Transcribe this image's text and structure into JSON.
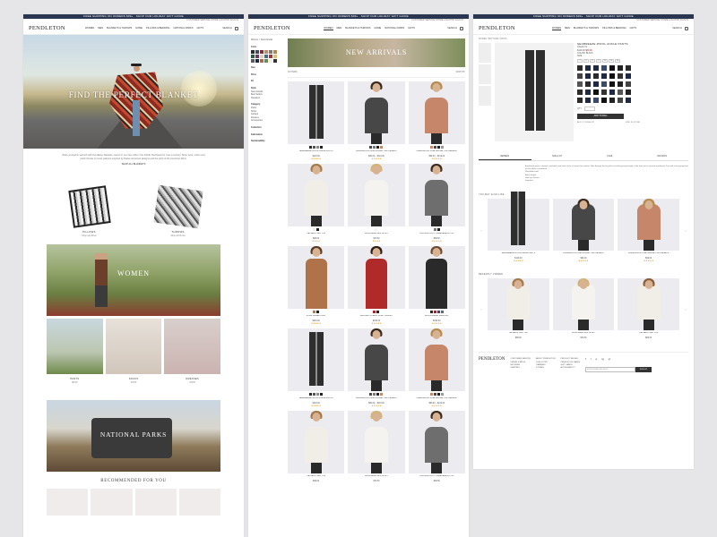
{
  "common": {
    "banner": "FREE SHIPPING ON ORDERS $99+ · SHOP OUR HOLIDAY GIFT GUIDE",
    "util": "CUSTOMER SERVICE   STORE LOCATOR   SIGN IN",
    "logo": "PENDLETON",
    "nav": [
      "WOMEN",
      "MEN",
      "BLANKETS & THROWS",
      "HOME",
      "PILLOWS & BEDDING",
      "NATIONAL PARKS",
      "GIFTS",
      "SALE"
    ],
    "search": "SEARCH",
    "cart_icon": "bag-icon"
  },
  "home": {
    "hero_title": "FIND THE PERFECT BLANKET",
    "intro": "Wrap yourself in warmth with Pendleton blankets, woven in our own mills in the Pacific Northwest for over a century. Shop wool, cotton and plush throws in iconic patterns inspired by Native American designs and the spirit of the American West.",
    "intro_link": "SHOP ALL BLANKETS",
    "duo": [
      {
        "title": "PILLOWS",
        "sub": "Shop all pillows"
      },
      {
        "title": "THROWS",
        "sub": "Shop all throws"
      }
    ],
    "women_title": "WOMEN",
    "women_tiles": [
      {
        "title": "PANTS",
        "sub": "SHOP"
      },
      {
        "title": "SOCKS",
        "sub": "SHOP"
      },
      {
        "title": "DRESSES",
        "sub": "SHOP"
      }
    ],
    "np_title": "NATIONAL PARKS",
    "reco_title": "RECOMMENDED FOR YOU"
  },
  "category": {
    "breadcrumb": "Women > New Arrivals",
    "filter_heads": [
      "Color",
      "Size",
      "Price",
      "Fit",
      "Style",
      "Category",
      "Collection",
      "Fabrication",
      "Sustainability"
    ],
    "filter_items": [
      "New Arrivals",
      "Best Sellers",
      "Sweaters",
      "Pants",
      "Shirts",
      "Jackets",
      "Dresses",
      "Accessories"
    ],
    "banner_title": "NEW ARRIVALS",
    "sort": "SORT BY",
    "count": "48 ITEMS",
    "products": [
      {
        "name": "SEABREEZE WOOL ANKLE PANTS",
        "price": "$129.00",
        "stars": "★★★★★",
        "colors": [
          "#2b2b2b",
          "#555",
          "#8a8a8a",
          "#222"
        ],
        "garment": "#2e2e2e",
        "hair": "#6b4a2f",
        "kind": "pants"
      },
      {
        "name": "LAMBSWOOL FINE GAUGE TURTLENECK",
        "price": "$99.00 – $119.00",
        "stars": "★★★★★",
        "colors": [
          "#4a4a4a",
          "#777",
          "#222",
          "#c38a6a"
        ],
        "garment": "#474747",
        "hair": "#3a2a1e",
        "kind": "top"
      },
      {
        "name": "LAMBSWOOL FINE GAUGE TURTLENECK",
        "price": "$99.00 – $119.00",
        "stars": "★★★★★",
        "colors": [
          "#c38a6a",
          "#4a4a4a",
          "#222",
          "#999"
        ],
        "garment": "#c5866a",
        "hair": "#b78a4d",
        "kind": "top"
      },
      {
        "name": "TIE-NECK SILK TOP",
        "price": "$89.00",
        "stars": "★★★★",
        "colors": [
          "#f2efe9",
          "#222"
        ],
        "garment": "#f1eee8",
        "hair": "#a57a4a",
        "kind": "top"
      },
      {
        "name": "WASHABLE SILK SHIRT",
        "price": "$79.50",
        "stars": "★★★★",
        "colors": [
          "#f5f3ef"
        ],
        "garment": "#f5f3ef",
        "hair": "#d3b37a",
        "kind": "top"
      },
      {
        "name": "HOUNDSTOOTH SLEEVELESS TOP",
        "price": "$89.50",
        "stars": "★★★★★",
        "colors": [
          "#777",
          "#222"
        ],
        "garment": "#6e6e6e",
        "hair": "#3d2b1f",
        "kind": "top"
      },
      {
        "name": "LONG CAMEL COAT",
        "price": "$349.00",
        "stars": "★★★★★",
        "colors": [
          "#b57a4c",
          "#222"
        ],
        "garment": "#b07349",
        "hair": "#5a3d28",
        "kind": "coat"
      },
      {
        "name": "BUFFALO CHECK SHIRT JACKET",
        "price": "$199.00",
        "stars": "★★★★★",
        "colors": [
          "#b2202a",
          "#222"
        ],
        "garment": "#b12a2a",
        "hair": "#2b1d14",
        "kind": "coat"
      },
      {
        "name": "WOOL BLEND PEACOAT",
        "price": "$299.00",
        "stars": "★★★★★",
        "colors": [
          "#2b2b2b",
          "#9b2c2c",
          "#3a4a6a",
          "#666"
        ],
        "garment": "#2a2a2a",
        "hair": "#6d4c33",
        "kind": "coat"
      },
      {
        "name": "SEABREEZE WOOL ANKLE PANTS",
        "price": "$129.00",
        "stars": "★★★★★",
        "colors": [
          "#2b2b2b",
          "#555",
          "#8a8a8a",
          "#222"
        ],
        "garment": "#2e2e2e",
        "hair": "#6b4a2f",
        "kind": "pants"
      },
      {
        "name": "LAMBSWOOL FINE GAUGE TURTLENECK",
        "price": "$99.00 – $119.00",
        "stars": "★★★★★",
        "colors": [
          "#4a4a4a",
          "#777",
          "#222",
          "#c38a6a"
        ],
        "garment": "#474747",
        "hair": "#3a2a1e",
        "kind": "top"
      },
      {
        "name": "LAMBSWOOL FINE GAUGE TURTLENECK",
        "price": "$99.00 – $119.00",
        "stars": "★★★★★",
        "colors": [
          "#c38a6a",
          "#4a4a4a",
          "#222",
          "#999"
        ],
        "garment": "#c5866a",
        "hair": "#b78a4d",
        "kind": "top"
      },
      {
        "name": "TIE-NECK SILK TOP",
        "price": "$89.00",
        "stars": "",
        "colors": [],
        "garment": "#f1eee8",
        "hair": "#a57a4a",
        "kind": "top"
      },
      {
        "name": "WASHABLE SILK SHIRT",
        "price": "$79.50",
        "stars": "",
        "colors": [],
        "garment": "#f5f3ef",
        "hair": "#d3b37a",
        "kind": "top"
      },
      {
        "name": "HOUNDSTOOTH SLEEVELESS TOP",
        "price": "$89.50",
        "stars": "",
        "colors": [],
        "garment": "#6e6e6e",
        "hair": "#3d2b1f",
        "kind": "top"
      }
    ]
  },
  "pdp": {
    "breadcrumb": "WOMEN / BOTTOMS / PANTS",
    "name": "SEABREEZE WOOL ANKLE PANTS",
    "subname": "Classic Fit",
    "price": "$129.00",
    "sale_price": "$89.99",
    "color_label": "COLOR: BLACK",
    "size_label": "SIZE",
    "sizes": [
      "2",
      "4",
      "6",
      "8",
      "10",
      "12",
      "14"
    ],
    "qty_label": "QTY",
    "add_to_bag": "ADD TO BAG",
    "wishlist": "ADD TO WISHLIST",
    "find_store": "FIND IN STORE",
    "tabs": [
      "DETAILS",
      "SIZE & FIT",
      "CARE",
      "REVIEWS"
    ],
    "description": "A polished pant in smooth, washable wool with a hint of stretch for comfort. Slim through the leg with an ankle-grazing length, a flat front and a smooth waistband. Pair with a fine-gauge knit for the office or weekend.",
    "bullets": [
      "Washable wool",
      "Ankle length",
      "Side zip closure",
      "Imported"
    ],
    "also_title": "YOU MAY ALSO LIKE",
    "recent_title": "RECENTLY VIEWED",
    "also": [
      {
        "name": "SEABREEZE WOOL ANKLE PANTS",
        "price": "$129.00",
        "stars": "★★★★★",
        "garment": "#2e2e2e",
        "hair": "#6b4a2f",
        "kind": "pants"
      },
      {
        "name": "LAMBSWOOL FINE GAUGE TURTLENECK",
        "price": "$99.00",
        "stars": "★★★★★",
        "garment": "#474747",
        "hair": "#3a2a1e",
        "kind": "top"
      },
      {
        "name": "LAMBSWOOL FINE GAUGE TURTLENECK",
        "price": "$99.00",
        "stars": "★★★★★",
        "garment": "#c5866a",
        "hair": "#b78a4d",
        "kind": "top"
      }
    ],
    "recent": [
      {
        "name": "TIE-NECK SILK TOP",
        "price": "$89.00",
        "garment": "#f1eee8",
        "hair": "#a57a4a",
        "kind": "top"
      },
      {
        "name": "WASHABLE SILK SHIRT",
        "price": "$79.50",
        "garment": "#f5f3ef",
        "hair": "#d3b37a",
        "kind": "top"
      },
      {
        "name": "TIE-NECK SILK TOP",
        "price": "$89.00",
        "garment": "#f1eee8",
        "hair": "#8b5e3c",
        "kind": "top"
      }
    ],
    "footer": {
      "logo": "PENDLETON",
      "col1": [
        "CUSTOMER SERVICE",
        "ORDER STATUS",
        "RETURNS",
        "SHIPPING"
      ],
      "col2": [
        "ABOUT PENDLETON",
        "OUR STORY",
        "CAREERS",
        "STORES"
      ],
      "col3": [
        "PRODUCT RECALL",
        "PENDLETON CARES",
        "GIFT CARDS",
        "ACCESSIBILITY"
      ],
      "signup_placeholder": "ENTER EMAIL ADDRESS",
      "signup_btn": "SIGN UP",
      "social": [
        "f",
        "t",
        "p",
        "ig",
        "yt"
      ]
    }
  }
}
